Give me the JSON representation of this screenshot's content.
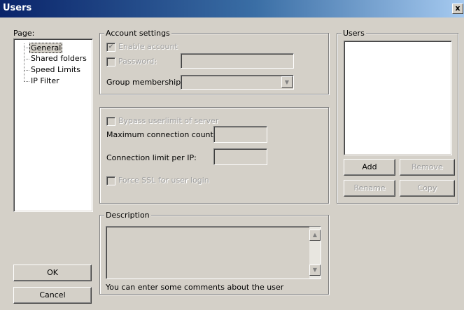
{
  "window": {
    "title": "Users",
    "close_label": "x"
  },
  "page_panel": {
    "label": "Page:",
    "items": [
      {
        "label": "General",
        "selected": true
      },
      {
        "label": "Shared folders",
        "selected": false
      },
      {
        "label": "Speed Limits",
        "selected": false
      },
      {
        "label": "IP Filter",
        "selected": false
      }
    ]
  },
  "account": {
    "group_title": "Account settings",
    "enable_account": {
      "label": "Enable account",
      "checked": true,
      "enabled": false
    },
    "password": {
      "label": "Password:",
      "checked": false,
      "value": ""
    },
    "group_membership": {
      "label": "Group membership:",
      "value": ""
    }
  },
  "limits": {
    "bypass": {
      "label": "Bypass userlimit of server",
      "checked": false
    },
    "max_conn": {
      "label": "Maximum connection count:",
      "value": ""
    },
    "conn_per_ip": {
      "label": "Connection limit per IP:",
      "value": ""
    },
    "force_ssl": {
      "label": "Force SSL for user login",
      "checked": false
    }
  },
  "description": {
    "group_title": "Description",
    "value": "",
    "hint": "You can enter some comments about the user"
  },
  "users": {
    "group_title": "Users",
    "items": [],
    "add_label": "Add",
    "remove_label": "Remove",
    "rename_label": "Rename",
    "copy_label": "Copy"
  },
  "footer": {
    "ok_label": "OK",
    "cancel_label": "Cancel"
  },
  "icons": {
    "check": "checkmark-icon",
    "dropdown": "chevron-down-icon",
    "scroll_up": "arrow-up-icon",
    "scroll_down": "arrow-down-icon"
  }
}
